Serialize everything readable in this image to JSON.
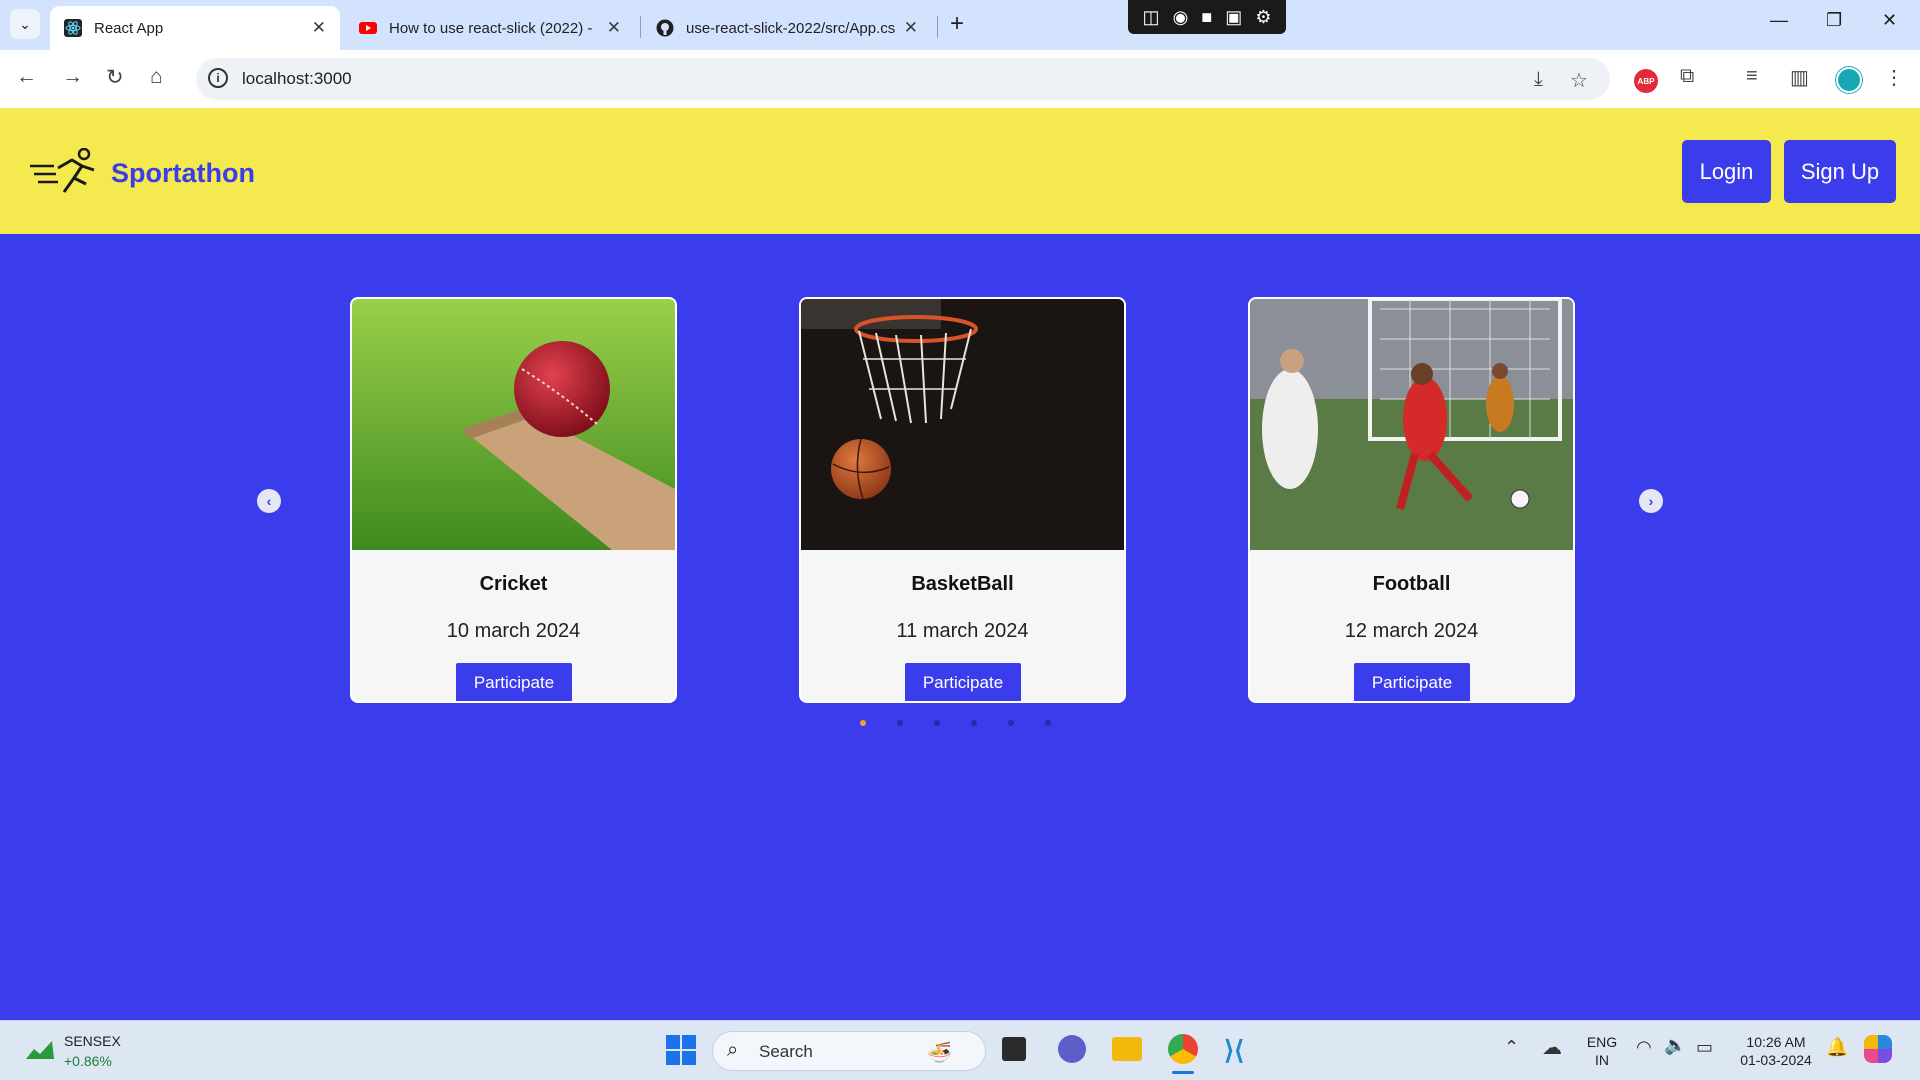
{
  "browser": {
    "tabs": [
      {
        "title": "React App",
        "active": true,
        "favicon": "react-icon"
      },
      {
        "title": "How to use react-slick (2022) -",
        "active": false,
        "favicon": "youtube-icon"
      },
      {
        "title": "use-react-slick-2022/src/App.cs",
        "active": false,
        "favicon": "github-icon"
      }
    ],
    "url": "localhost:3000",
    "extension_abp_label": "ABP"
  },
  "app": {
    "brand": "Sportathon",
    "login_label": "Login",
    "signup_label": "Sign Up",
    "accent_color": "#3b3ceb",
    "header_color": "#f4ea50"
  },
  "events": [
    {
      "name": "Cricket",
      "date": "10 march 2024",
      "button": "Participate",
      "image": "cricket-ball-on-bat"
    },
    {
      "name": "BasketBall",
      "date": "11 march 2024",
      "button": "Participate",
      "image": "basketball-hoop"
    },
    {
      "name": "Football",
      "date": "12 march 2024",
      "button": "Participate",
      "image": "football-match"
    }
  ],
  "carousel": {
    "dots": 6,
    "active_dot": 1
  },
  "taskbar": {
    "sensex_name": "SENSEX",
    "sensex_change": "+0.86%",
    "search_label": "Search",
    "lang_line1": "ENG",
    "lang_line2": "IN",
    "time": "10:26 AM",
    "date": "01-03-2024"
  }
}
